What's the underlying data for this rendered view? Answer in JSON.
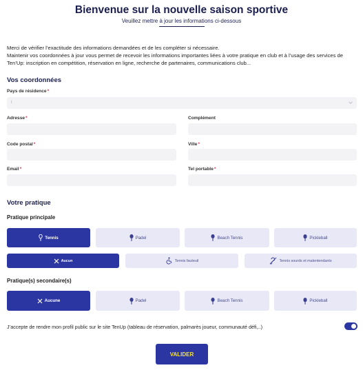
{
  "header": {
    "title": "Bienvenue sur la nouvelle saison sportive",
    "subtitle": "Veuillez mettre à jour les informations ci-dessous"
  },
  "intro": {
    "line1": "Merci de vérifier l’exactitude des informations demandées et de les compléter si nécessaire.",
    "line2": "Maintenir vos coordonnées à jour vous permet de recevoir les informations importantes liées à votre pratique en club et à l’usage des services de Ten’Up: inscription en compétition, réservation en ligne, recherche de partenaires, communications club..."
  },
  "coordonnees": {
    "title": "Vos coordonnées",
    "required_mark": "*",
    "pays": {
      "label": "Pays de résidence",
      "value": "I"
    },
    "adresse": {
      "label": "Adresse",
      "value": ""
    },
    "complement": {
      "label": "Complément",
      "value": ""
    },
    "code_postal": {
      "label": "Code postal",
      "value": ""
    },
    "ville": {
      "label": "Ville",
      "value": ""
    },
    "email": {
      "label": "Email",
      "value": ""
    },
    "tel": {
      "label": "Tel portable",
      "value": ""
    }
  },
  "pratique": {
    "title": "Votre pratique",
    "principale_label": "Pratique principale",
    "principale": [
      {
        "label": "Tennis",
        "icon": "tennis-racket-icon",
        "selected": true
      },
      {
        "label": "Padel",
        "icon": "padel-racket-icon",
        "selected": false
      },
      {
        "label": "Beach Tennis",
        "icon": "beach-tennis-racket-icon",
        "selected": false
      },
      {
        "label": "Pickleball",
        "icon": "pickleball-paddle-icon",
        "selected": false
      }
    ],
    "handi": [
      {
        "label": "Aucun",
        "icon": "close-icon",
        "selected": true
      },
      {
        "label": "Tennis fauteuil",
        "icon": "wheelchair-icon",
        "selected": false
      },
      {
        "label": "Tennis sourds et malentendants",
        "icon": "hearing-impaired-icon",
        "selected": false
      }
    ],
    "secondaire_label": "Pratique(s) secondaire(s)",
    "secondaire": [
      {
        "label": "Aucune",
        "icon": "close-icon",
        "selected": true
      },
      {
        "label": "Padel",
        "icon": "padel-racket-icon",
        "selected": false
      },
      {
        "label": "Beach Tennis",
        "icon": "beach-tennis-racket-icon",
        "selected": false
      },
      {
        "label": "Pickleball",
        "icon": "pickleball-paddle-icon",
        "selected": false
      }
    ]
  },
  "consent": {
    "text": "J’accepte de rendre mon profil public sur le site TenUp (tableau de réservation, palmarès joueur, communauté défi,..)",
    "enabled": true
  },
  "submit_label": "VALIDER",
  "colors": {
    "primary": "#2c36a3",
    "button_text": "#f3e23a",
    "title": "#1b1f4f",
    "required": "#e0334f"
  }
}
